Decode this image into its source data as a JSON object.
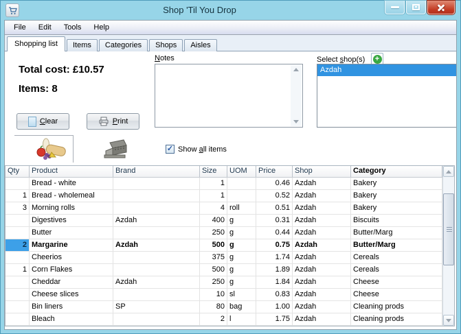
{
  "window": {
    "title": "Shop 'Til You Drop"
  },
  "menu": {
    "items": [
      "File",
      "Edit",
      "Tools",
      "Help"
    ]
  },
  "tabs": [
    {
      "label": "Shopping list",
      "active": true
    },
    {
      "label": "Items",
      "active": false
    },
    {
      "label": "Categories",
      "active": false
    },
    {
      "label": "Shops",
      "active": false
    },
    {
      "label": "Aisles",
      "active": false
    }
  ],
  "summary": {
    "total_cost": "Total cost: £10.57",
    "items_count": "Items: 8"
  },
  "actions": {
    "clear": {
      "mnemonic": "C",
      "rest": "lear"
    },
    "print": {
      "mnemonic": "P",
      "rest": "rint"
    }
  },
  "notes": {
    "label_mnemonic": "N",
    "label_rest": "otes",
    "value": ""
  },
  "shops": {
    "label_pre": "Select ",
    "label_mnemonic": "s",
    "label_rest": "hop(s)",
    "items": [
      "Azdah"
    ],
    "selected": "Azdah"
  },
  "toolbar": {
    "show_all_pre": "Show ",
    "show_all_mnemonic": "a",
    "show_all_rest": "ll items",
    "checked": true
  },
  "icons": {
    "app": "shopping-cart",
    "add_shop": "+",
    "check": "✓"
  },
  "table": {
    "headers": [
      "Qty",
      "Product",
      "Brand",
      "Size",
      "UOM",
      "Price",
      "Shop",
      "Category"
    ],
    "sorted_by": "Category",
    "selected_row": 5,
    "rows": [
      {
        "qty": "",
        "product": "Bread - white",
        "brand": "",
        "size": "1",
        "uom": "",
        "price": "0.46",
        "shop": "Azdah",
        "category": "Bakery"
      },
      {
        "qty": "1",
        "product": "Bread - wholemeal",
        "brand": "",
        "size": "1",
        "uom": "",
        "price": "0.52",
        "shop": "Azdah",
        "category": "Bakery"
      },
      {
        "qty": "3",
        "product": "Morning rolls",
        "brand": "",
        "size": "4",
        "uom": "roll",
        "price": "0.51",
        "shop": "Azdah",
        "category": "Bakery"
      },
      {
        "qty": "",
        "product": "Digestives",
        "brand": "Azdah",
        "size": "400",
        "uom": "g",
        "price": "0.31",
        "shop": "Azdah",
        "category": "Biscuits"
      },
      {
        "qty": "",
        "product": "Butter",
        "brand": "",
        "size": "250",
        "uom": "g",
        "price": "0.44",
        "shop": "Azdah",
        "category": "Butter/Marg"
      },
      {
        "qty": "2",
        "product": "Margarine",
        "brand": "Azdah",
        "size": "500",
        "uom": "g",
        "price": "0.75",
        "shop": "Azdah",
        "category": "Butter/Marg"
      },
      {
        "qty": "",
        "product": "Cheerios",
        "brand": "",
        "size": "375",
        "uom": "g",
        "price": "1.74",
        "shop": "Azdah",
        "category": "Cereals"
      },
      {
        "qty": "1",
        "product": "Corn Flakes",
        "brand": "",
        "size": "500",
        "uom": "g",
        "price": "1.89",
        "shop": "Azdah",
        "category": "Cereals"
      },
      {
        "qty": "",
        "product": "Cheddar",
        "brand": "Azdah",
        "size": "250",
        "uom": "g",
        "price": "1.84",
        "shop": "Azdah",
        "category": "Cheese"
      },
      {
        "qty": "",
        "product": "Cheese slices",
        "brand": "",
        "size": "10",
        "uom": "sl",
        "price": "0.83",
        "shop": "Azdah",
        "category": "Cheese"
      },
      {
        "qty": "",
        "product": "Bin liners",
        "brand": "SP",
        "size": "80",
        "uom": "bag",
        "price": "1.00",
        "shop": "Azdah",
        "category": "Cleaning prods"
      },
      {
        "qty": "",
        "product": "Bleach",
        "brand": "",
        "size": "2",
        "uom": "l",
        "price": "1.75",
        "shop": "Azdah",
        "category": "Cleaning prods"
      }
    ]
  },
  "colors": {
    "titlebar": "#97d5e8",
    "selection_blue": "#3093e1",
    "close_button_red": "#c23a22"
  }
}
